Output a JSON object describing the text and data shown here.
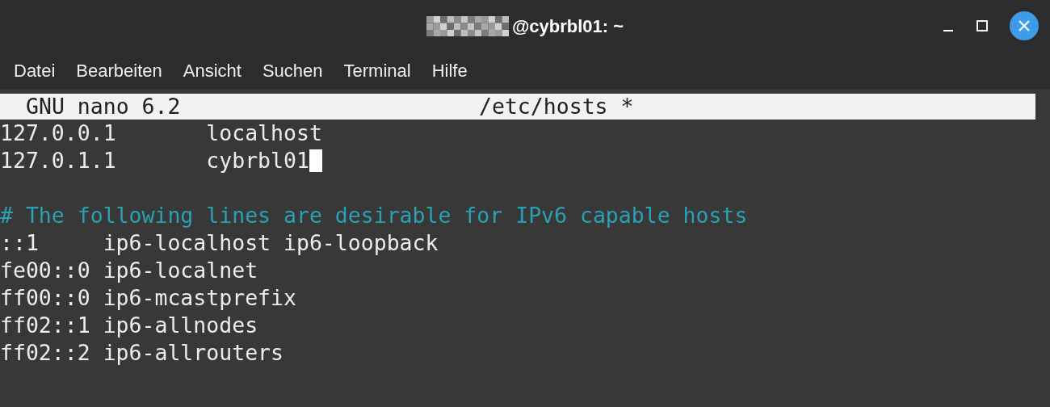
{
  "window": {
    "title": "@cybrbl01: ~",
    "title_redacted": true
  },
  "menu": [
    "Datei",
    "Bearbeiten",
    "Ansicht",
    "Suchen",
    "Terminal",
    "Hilfe"
  ],
  "nano": {
    "version": "GNU nano 6.2",
    "file": "/etc/hosts *"
  },
  "lines": [
    {
      "kind": "text",
      "text": "127.0.0.1       localhost"
    },
    {
      "kind": "text",
      "text": "127.0.1.1       cybrbl01",
      "cursor": true
    },
    {
      "kind": "blank"
    },
    {
      "kind": "comment",
      "text": "# The following lines are desirable for IPv6 capable hosts"
    },
    {
      "kind": "text",
      "text": "::1     ip6-localhost ip6-loopback"
    },
    {
      "kind": "text",
      "text": "fe00::0 ip6-localnet"
    },
    {
      "kind": "text",
      "text": "ff00::0 ip6-mcastprefix"
    },
    {
      "kind": "text",
      "text": "ff02::1 ip6-allnodes"
    },
    {
      "kind": "text",
      "text": "ff02::2 ip6-allrouters"
    }
  ]
}
